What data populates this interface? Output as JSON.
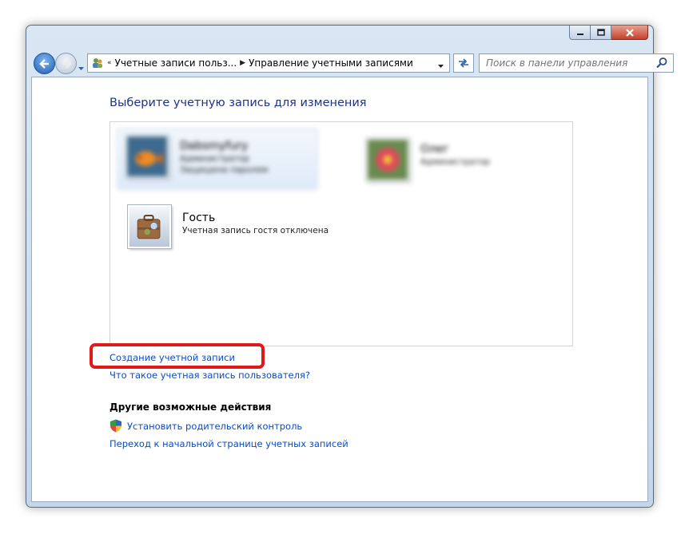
{
  "address_bar": {
    "prefix": "«",
    "crumbs": [
      "Учетные записи польз...",
      "Управление учетными записями"
    ]
  },
  "search": {
    "placeholder": "Поиск в панели управления"
  },
  "main": {
    "title": "Выберите учетную запись для изменения",
    "accounts": [
      {
        "name": "Dabsmyfury",
        "line1": "Администратор",
        "line2": "Защищена паролем"
      },
      {
        "name": "Олег",
        "line1": "Администратор",
        "line2": ""
      },
      {
        "name": "Гость",
        "line1": "Учетная запись гостя отключена",
        "line2": ""
      }
    ],
    "create_link": "Создание учетной записи",
    "what_link": "Что такое учетная запись пользователя?",
    "other_actions": {
      "title": "Другие возможные действия",
      "parental_control": "Установить родительский контроль",
      "home_link": "Переход к начальной странице учетных записей"
    }
  },
  "colors": {
    "link": "#0b4bc2",
    "title": "#1e3287",
    "highlight": "#e01919"
  }
}
